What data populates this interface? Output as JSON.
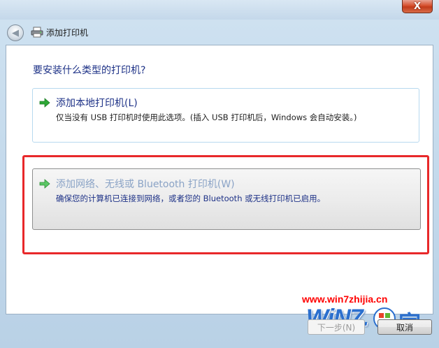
{
  "window": {
    "title": "添加打印机",
    "close_label": "X"
  },
  "main": {
    "question": "要安装什么类型的打印机?",
    "options": [
      {
        "title": "添加本地打印机(L)",
        "description": "仅当没有 USB 打印机时使用此选项。(插入 USB 打印机后，Windows 会自动安装。)"
      },
      {
        "title": "添加网络、无线或 Bluetooth 打印机(W)",
        "description": "确保您的计算机已连接到网络，或者您的 Bluetooth 或无线打印机已启用。"
      }
    ]
  },
  "footer": {
    "watermark_url": "www.win7zhijia.cn",
    "logo_text": "WiN7.",
    "logo_glyph": "家",
    "next_label": "下一步(N)",
    "cancel_label": "取消"
  },
  "colors": {
    "highlight_frame": "#e8282a",
    "title_text": "#1e3287",
    "arrow_green": "#2ea836"
  }
}
